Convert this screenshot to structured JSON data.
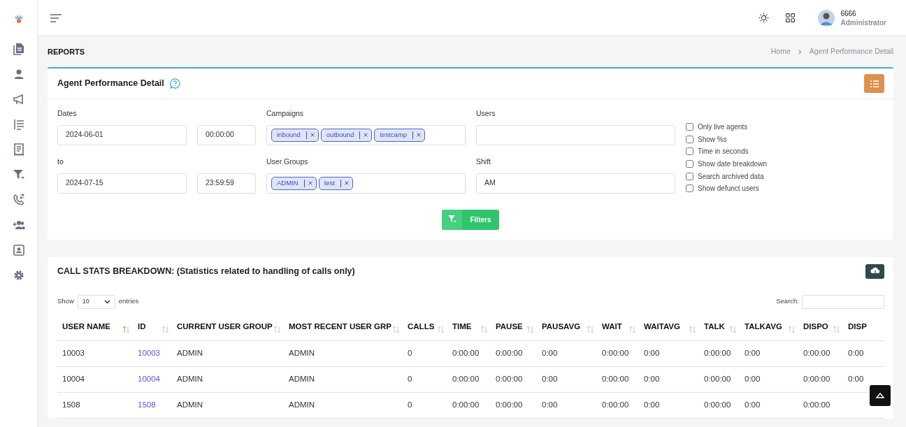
{
  "header": {
    "user_name": "6666",
    "user_role": "Administrator"
  },
  "page_title": "REPORTS",
  "breadcrumb": [
    {
      "label": "Home"
    },
    {
      "label": "Agent Performance Detail"
    }
  ],
  "filter_card": {
    "title": "Agent Performance Detail",
    "dates_label": "Dates",
    "start_date": "2024-06-01",
    "start_time": "00:00:00",
    "to_label": "to",
    "end_date": "2024-07-15",
    "end_time": "23:59:59",
    "campaigns_label": "Campaigns",
    "campaigns": [
      {
        "label": "inbound"
      },
      {
        "label": "outbound"
      },
      {
        "label": "testcamp"
      }
    ],
    "user_groups_label": "User Groups",
    "user_groups": [
      {
        "label": "ADMIN"
      },
      {
        "label": "test"
      }
    ],
    "users_label": "Users",
    "shift_label": "Shift",
    "shift": "AM",
    "options": [
      {
        "label": "Only live agents",
        "checked": false
      },
      {
        "label": "Show %s",
        "checked": false
      },
      {
        "label": "Time in seconds",
        "checked": false
      },
      {
        "label": "Show date breakdown",
        "checked": false
      },
      {
        "label": "Search archived data",
        "checked": false
      },
      {
        "label": "Show defunct users",
        "checked": false
      }
    ],
    "filter_button": "Filters"
  },
  "stats_card": {
    "title": "CALL STATS BREAKDOWN: (Statistics related to handling of calls only)",
    "show_label": "Show",
    "page_size": "10",
    "entries_label": "entries",
    "search_label": "Search:",
    "columns": [
      {
        "label": "USER NAME",
        "sorted_ascending": true,
        "kind": "text"
      },
      {
        "label": "ID",
        "sorted_ascending": false,
        "kind": "link"
      },
      {
        "label": "CURRENT USER GROUP",
        "sorted_ascending": false,
        "kind": "text"
      },
      {
        "label": "MOST RECENT USER GRP",
        "sorted_ascending": false,
        "kind": "text"
      },
      {
        "label": "CALLS",
        "sorted_ascending": false,
        "kind": "text"
      },
      {
        "label": "TIME",
        "sorted_ascending": false,
        "kind": "text"
      },
      {
        "label": "PAUSE",
        "sorted_ascending": false,
        "kind": "text"
      },
      {
        "label": "PAUSAVG",
        "sorted_ascending": false,
        "kind": "text"
      },
      {
        "label": "WAIT",
        "sorted_ascending": false,
        "kind": "text"
      },
      {
        "label": "WAITAVG",
        "sorted_ascending": false,
        "kind": "text"
      },
      {
        "label": "TALK",
        "sorted_ascending": false,
        "kind": "text"
      },
      {
        "label": "TALKAVG",
        "sorted_ascending": false,
        "kind": "text"
      },
      {
        "label": "DISPO",
        "sorted_ascending": false,
        "kind": "text"
      },
      {
        "label": "DISP",
        "kind": "text"
      }
    ],
    "rows": [
      [
        "10003",
        "10003",
        "ADMIN",
        "ADMIN",
        "0",
        "0:00:00",
        "0:00:00",
        "0:00",
        "0:00:00",
        "0:00",
        "0:00:00",
        "0:00",
        "0:00:00",
        "0:00"
      ],
      [
        "10004",
        "10004",
        "ADMIN",
        "ADMIN",
        "0",
        "0:00:00",
        "0:00:00",
        "0:00",
        "0:00:00",
        "0:00",
        "0:00:00",
        "0:00",
        "0:00:00",
        "0:00"
      ],
      [
        "1508",
        "1508",
        "ADMIN",
        "ADMIN",
        "0",
        "0:00:00",
        "0:00:00",
        "0:00",
        "0:00:00",
        "0:00",
        "0:00:00",
        "0:00",
        "0:00:00"
      ]
    ]
  }
}
